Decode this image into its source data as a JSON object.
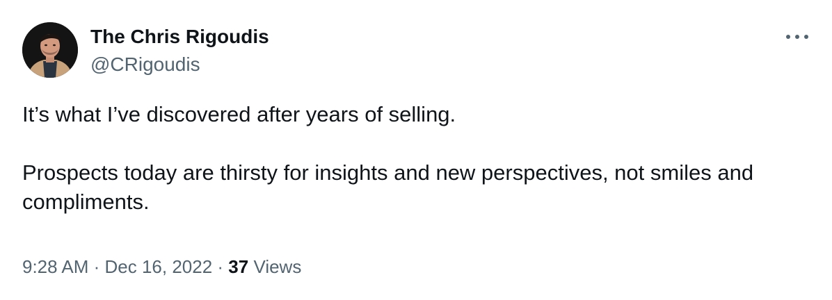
{
  "author": {
    "display_name": "The Chris Rigoudis",
    "handle": "@CRigoudis",
    "avatar_icon": "profile-photo"
  },
  "more_icon": "more-horizontal-icon",
  "tweet": {
    "paragraphs": [
      "It’s what I’ve discovered after years of selling.",
      "Prospects today are thirsty for insights and new perspectives, not smiles and compliments."
    ]
  },
  "meta": {
    "time": "9:28 AM",
    "separator": "·",
    "date": "Dec 16, 2022",
    "separator2": "·",
    "views_count": "37",
    "views_label": "Views"
  },
  "colors": {
    "primary_text": "#0f1419",
    "secondary_text": "#536471",
    "background": "#ffffff"
  }
}
